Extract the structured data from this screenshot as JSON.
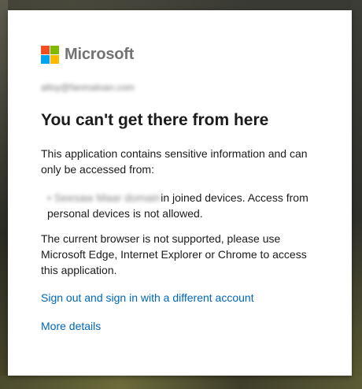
{
  "brand": {
    "name": "Microsoft"
  },
  "account": {
    "email": "alloy@fanmaloan.com"
  },
  "title": "You can't get there from here",
  "body": {
    "intro": "This application contains sensitive information and can only be accessed from:",
    "requirement_blurred": "• Seesaw Maar domain",
    "requirement_line1": "in joined devices. Access from",
    "requirement_line2": "personal devices is not allowed.",
    "browser_notice": "The current browser is not supported, please use Microsoft Edge, Internet Explorer or Chrome to access this application."
  },
  "links": {
    "sign_out": "Sign out and sign in with a different account",
    "more_details": "More details"
  },
  "colors": {
    "link": "#0067b8",
    "title": "#1b1b1b",
    "logo_text": "#737373"
  },
  "icons": {
    "logo": "microsoft-logo-icon"
  }
}
